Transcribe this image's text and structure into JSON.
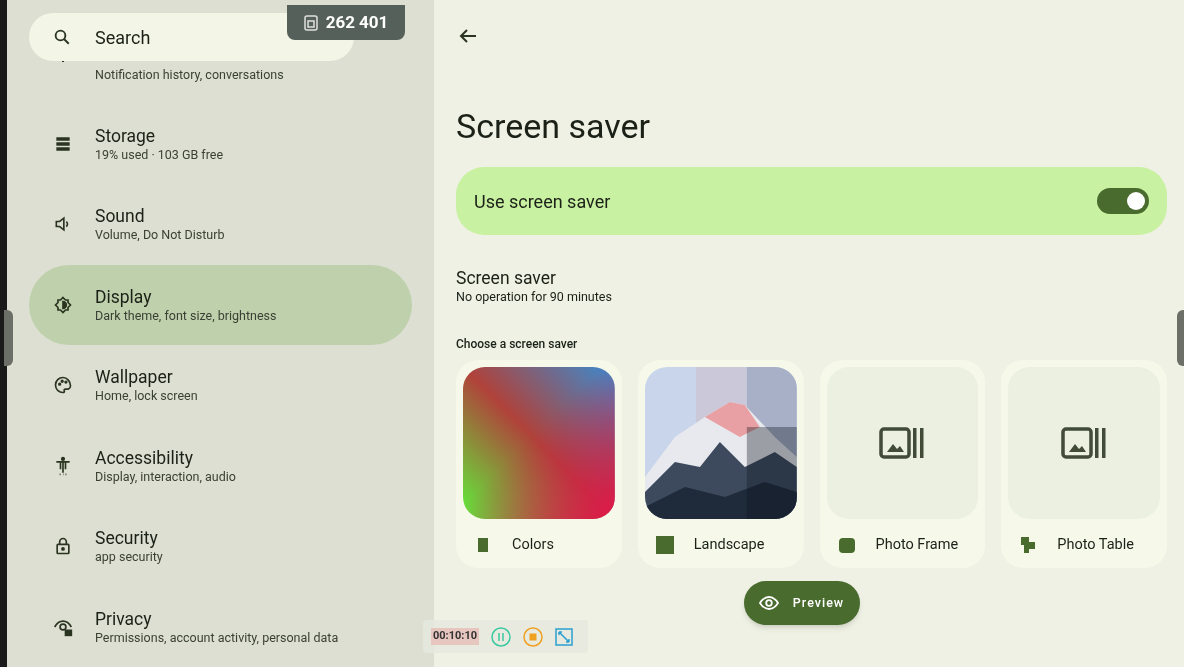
{
  "sidebar": {
    "search": {
      "placeholder": "Search"
    },
    "items": [
      {
        "kind": "partial",
        "subtitle": "Notification history, conversations",
        "selected": false
      },
      {
        "kind": "full",
        "title": "Storage",
        "subtitle": "19% used · 103 GB free",
        "selected": false
      },
      {
        "kind": "full",
        "title": "Sound",
        "subtitle": "Volume, Do Not Disturb",
        "selected": false
      },
      {
        "kind": "full",
        "title": "Display",
        "subtitle": "Dark theme, font size, brightness",
        "selected": true
      },
      {
        "kind": "full",
        "title": "Wallpaper",
        "subtitle": "Home, lock screen",
        "selected": false
      },
      {
        "kind": "full",
        "title": "Accessibility",
        "subtitle": "Display, interaction, audio",
        "selected": false
      },
      {
        "kind": "full",
        "title": "Security",
        "subtitle": "app security",
        "selected": false
      },
      {
        "kind": "full",
        "title": "Privacy",
        "subtitle": "Permissions, account activity, personal data",
        "selected": false
      }
    ]
  },
  "counter_badge": {
    "text": "262 401"
  },
  "recorder": {
    "timer": "00:10:10"
  },
  "main": {
    "title": "Screen saver",
    "toggle": {
      "label": "Use screen saver",
      "on": true
    },
    "setting": {
      "title": "Screen saver",
      "subtitle": "No operation for 90 minutes"
    },
    "section_label": "Choose a screen saver",
    "options": [
      {
        "kind": "gradient",
        "label": "Colors"
      },
      {
        "kind": "picture",
        "label": "Landscape"
      },
      {
        "kind": "placeholder",
        "label": "Photo Frame"
      },
      {
        "kind": "placeholder",
        "label": "Photo Table"
      }
    ],
    "preview_button": "Preview"
  }
}
